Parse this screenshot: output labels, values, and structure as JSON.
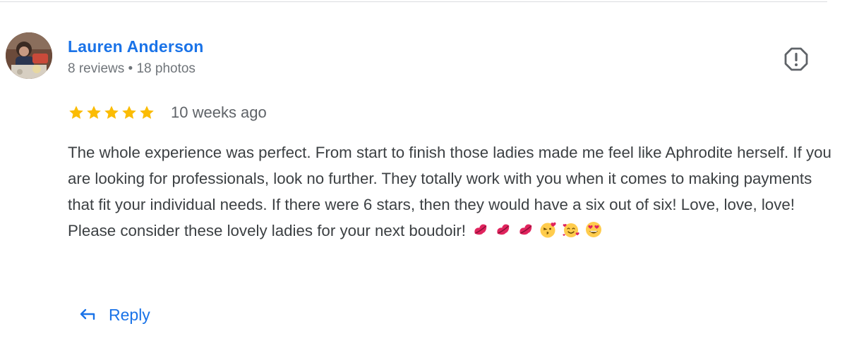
{
  "reviewer": {
    "name": "Lauren Anderson",
    "meta": "8 reviews • 18 photos"
  },
  "review": {
    "rating": 5,
    "rating_max": 5,
    "date": "10 weeks ago",
    "text": "The whole experience was perfect. From start to finish those ladies made me feel like Aphrodite herself. If you are looking for professionals, look no further. They totally work with you when it comes to making payments that fit your individual needs. If there were 6 stars, then they would have a six out of six! Love, love, love! Please consider these lovely ladies for your next boudoir!",
    "emojis": [
      "kiss-mark-emoji",
      "kiss-mark-emoji",
      "kiss-mark-emoji",
      "face-blowing-kiss-emoji",
      "smiling-face-with-hearts-emoji",
      "heart-eyes-emoji"
    ]
  },
  "actions": {
    "reply_label": "Reply",
    "flag_icon": "flag-report-icon"
  },
  "colors": {
    "name_blue": "#1a73e8",
    "star_yellow": "#fbbc04",
    "text": "#3c4043",
    "meta": "#70757a"
  }
}
